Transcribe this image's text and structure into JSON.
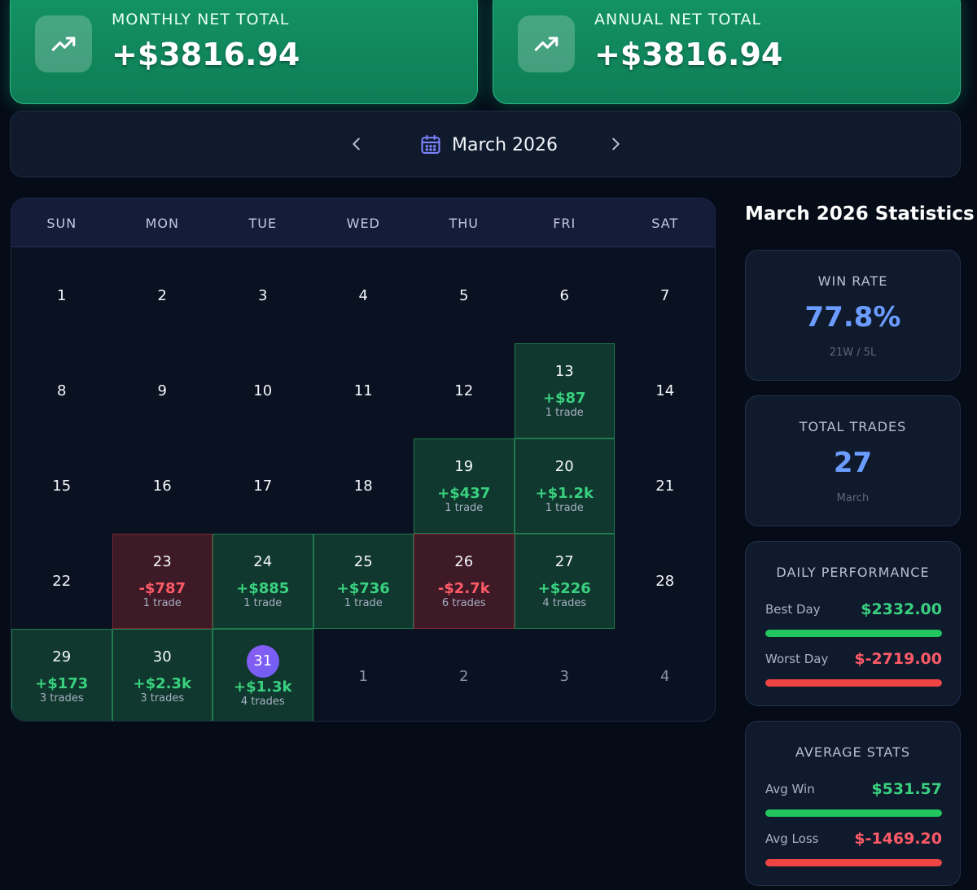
{
  "summary": {
    "monthly": {
      "label": "MONTHLY NET TOTAL",
      "value": "+$3816.94",
      "icon": "trending-up-icon"
    },
    "annual": {
      "label": "ANNUAL NET TOTAL",
      "value": "+$3816.94",
      "icon": "trending-up-icon"
    }
  },
  "nav": {
    "month_title": "March 2026",
    "prev_icon": "chevron-left-icon",
    "next_icon": "chevron-right-icon",
    "calendar_icon": "calendar-icon"
  },
  "calendar": {
    "weekdays": [
      "SUN",
      "MON",
      "TUE",
      "WED",
      "THU",
      "FRI",
      "SAT"
    ],
    "weeks": [
      [
        {
          "day": "1"
        },
        {
          "day": "2"
        },
        {
          "day": "3"
        },
        {
          "day": "4"
        },
        {
          "day": "5"
        },
        {
          "day": "6"
        },
        {
          "day": "7"
        }
      ],
      [
        {
          "day": "8"
        },
        {
          "day": "9"
        },
        {
          "day": "10"
        },
        {
          "day": "11"
        },
        {
          "day": "12"
        },
        {
          "day": "13",
          "pnl": "+$87",
          "trades": "1 trade",
          "status": "win"
        },
        {
          "day": "14"
        }
      ],
      [
        {
          "day": "15"
        },
        {
          "day": "16"
        },
        {
          "day": "17"
        },
        {
          "day": "18"
        },
        {
          "day": "19",
          "pnl": "+$437",
          "trades": "1 trade",
          "status": "win"
        },
        {
          "day": "20",
          "pnl": "+$1.2k",
          "trades": "1 trade",
          "status": "win"
        },
        {
          "day": "21"
        }
      ],
      [
        {
          "day": "22"
        },
        {
          "day": "23",
          "pnl": "-$787",
          "trades": "1 trade",
          "status": "loss"
        },
        {
          "day": "24",
          "pnl": "+$885",
          "trades": "1 trade",
          "status": "win"
        },
        {
          "day": "25",
          "pnl": "+$736",
          "trades": "1 trade",
          "status": "win"
        },
        {
          "day": "26",
          "pnl": "-$2.7k",
          "trades": "6 trades",
          "status": "loss"
        },
        {
          "day": "27",
          "pnl": "+$226",
          "trades": "4 trades",
          "status": "win"
        },
        {
          "day": "28"
        }
      ],
      [
        {
          "day": "29",
          "pnl": "+$173",
          "trades": "3 trades",
          "status": "win"
        },
        {
          "day": "30",
          "pnl": "+$2.3k",
          "trades": "3 trades",
          "status": "win"
        },
        {
          "day": "31",
          "pnl": "+$1.3k",
          "trades": "4 trades",
          "status": "win",
          "today": true
        },
        {
          "day": "1",
          "other": true
        },
        {
          "day": "2",
          "other": true
        },
        {
          "day": "3",
          "other": true
        },
        {
          "day": "4",
          "other": true
        }
      ]
    ]
  },
  "stats": {
    "title": "March 2026 Statistics",
    "win_rate": {
      "label": "WIN RATE",
      "value": "77.8%",
      "sub": "21W / 5L"
    },
    "total_trades": {
      "label": "TOTAL TRADES",
      "value": "27",
      "sub": "March"
    },
    "daily": {
      "label": "DAILY PERFORMANCE",
      "best_label": "Best Day",
      "best_value": "$2332.00",
      "best_fill": 1.0,
      "worst_label": "Worst Day",
      "worst_value": "$-2719.00",
      "worst_fill": 1.0
    },
    "average": {
      "label": "AVERAGE STATS",
      "win_label": "Avg Win",
      "win_value": "$531.57",
      "win_fill": 1.0,
      "loss_label": "Avg Loss",
      "loss_value": "$-1469.20",
      "loss_fill": 1.0
    }
  },
  "colors": {
    "positive": "#39d17f",
    "negative": "#ff5a67",
    "accent": "#6b9cff",
    "today": "#8b5cf6"
  }
}
